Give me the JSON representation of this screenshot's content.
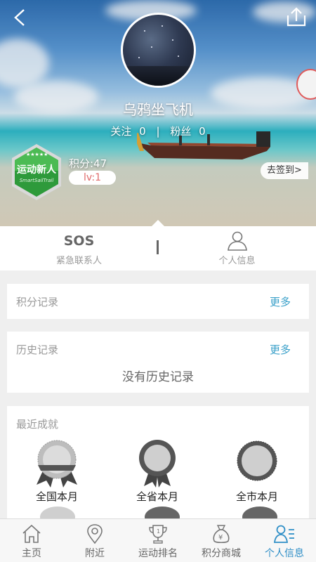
{
  "profile": {
    "username": "乌鸦坐飞机",
    "follow_label": "关注",
    "follow_count": "0",
    "fans_label": "粉丝",
    "fans_count": "0",
    "badge_text": "运动新人",
    "badge_subtext": "SmartSailTrail",
    "points_text": "积分:47",
    "level_text": "lv:1",
    "checkin_label": "去签到>"
  },
  "quick_bar": {
    "sos_title": "SOS",
    "sos_subtitle": "紧急联系人",
    "personal_info_label": "个人信息"
  },
  "points_record": {
    "title": "积分记录",
    "more_label": "更多"
  },
  "history_record": {
    "title": "历史记录",
    "more_label": "更多",
    "empty_text": "没有历史记录"
  },
  "achievements": {
    "title": "最近成就",
    "items": [
      {
        "label": "全国本月",
        "icon": "ribbon-medal-icon"
      },
      {
        "label": "全省本月",
        "icon": "ribbon-medal-icon"
      },
      {
        "label": "全市本月",
        "icon": "round-medal-icon"
      }
    ]
  },
  "tabbar": {
    "items": [
      {
        "label": "主页",
        "icon": "home-icon"
      },
      {
        "label": "附近",
        "icon": "location-pin-icon"
      },
      {
        "label": "运动排名",
        "icon": "trophy-icon"
      },
      {
        "label": "积分商城",
        "icon": "money-bag-icon"
      },
      {
        "label": "个人信息",
        "icon": "profile-list-icon"
      }
    ],
    "active_index": 4
  },
  "colors": {
    "accent_blue": "#2f8fc7",
    "more_link": "#3aa0c9",
    "level_text": "#e06a6a",
    "badge_green": "#2e9a3b"
  }
}
